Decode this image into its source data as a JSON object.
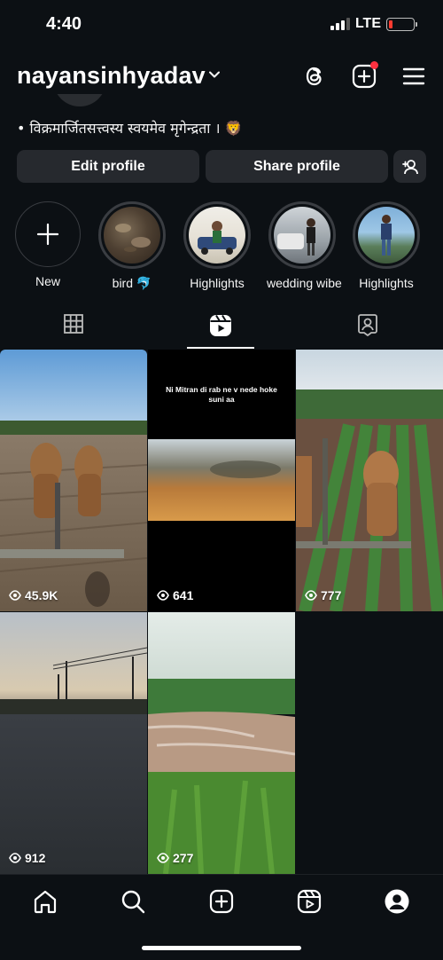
{
  "status_bar": {
    "time": "4:40",
    "network": "LTE",
    "battery_color": "#ff3b30"
  },
  "header": {
    "username": "nayansinhyadav",
    "icons": [
      "threads-icon",
      "create-icon",
      "menu-icon"
    ],
    "notification_color": "#ff3040"
  },
  "bio": "• विक्रमार्जितसत्त्वस्य स्वयमेव मृगेन्द्रता । 🦁",
  "buttons": {
    "edit_profile": "Edit profile",
    "share_profile": "Share profile",
    "add_person_icon": "add-person-icon"
  },
  "highlights": [
    {
      "label": "New"
    },
    {
      "label": "bird 🐬"
    },
    {
      "label": "Highlights"
    },
    {
      "label": "wedding wibe"
    },
    {
      "label": "Highlights"
    }
  ],
  "tabs": [
    "grid-icon",
    "reels-icon",
    "tagged-icon"
  ],
  "grid": [
    {
      "views": "45.9K"
    },
    {
      "views": "641",
      "overlay_text": "Ni Mitran di rab ne v nede hoke suni aa"
    },
    {
      "views": "777"
    },
    {
      "views": "912"
    },
    {
      "views": "277"
    }
  ],
  "bottom_nav": [
    "home-icon",
    "search-icon",
    "create-icon",
    "reels-icon",
    "profile-icon"
  ]
}
